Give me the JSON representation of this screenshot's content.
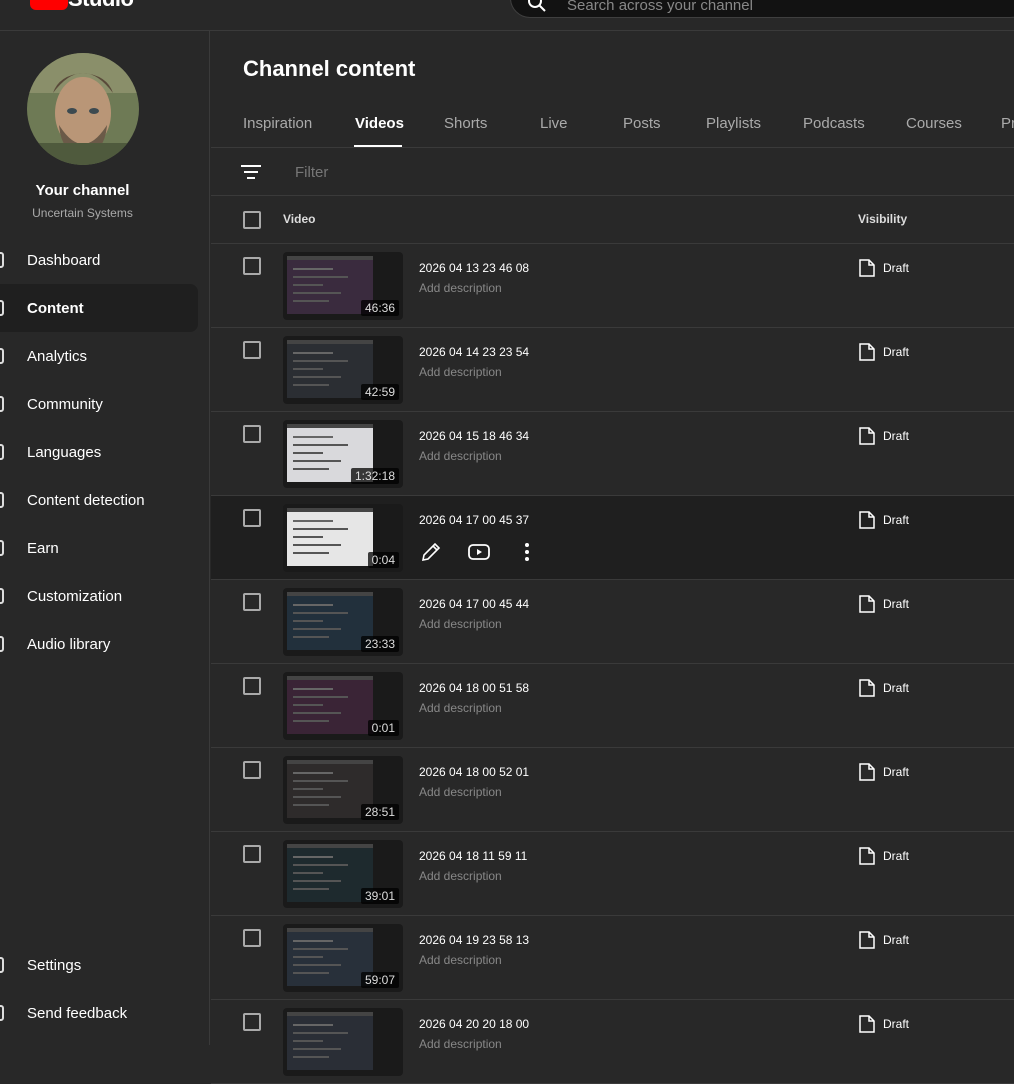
{
  "app": {
    "logo_text": "Studio"
  },
  "search": {
    "placeholder": "Search across your channel"
  },
  "sidebar": {
    "channel_title": "Your channel",
    "channel_name": "Uncertain Systems",
    "items": [
      {
        "label": "Dashboard",
        "icon": "dashboard-icon"
      },
      {
        "label": "Content",
        "icon": "content-icon",
        "active": true
      },
      {
        "label": "Analytics",
        "icon": "analytics-icon"
      },
      {
        "label": "Community",
        "icon": "community-icon"
      },
      {
        "label": "Languages",
        "icon": "languages-icon"
      },
      {
        "label": "Content detection",
        "icon": "content-detection-icon"
      },
      {
        "label": "Earn",
        "icon": "earn-icon"
      },
      {
        "label": "Customization",
        "icon": "customization-icon"
      },
      {
        "label": "Audio library",
        "icon": "audio-library-icon"
      }
    ],
    "bottom_items": [
      {
        "label": "Settings",
        "icon": "settings-icon"
      },
      {
        "label": "Send feedback",
        "icon": "feedback-icon"
      }
    ]
  },
  "main": {
    "title": "Channel content",
    "tabs": [
      "Inspiration",
      "Videos",
      "Shorts",
      "Live",
      "Posts",
      "Playlists",
      "Podcasts",
      "Courses",
      "Pr"
    ],
    "active_tab": "Videos",
    "filter_placeholder": "Filter",
    "columns": {
      "video": "Video",
      "visibility": "Visibility"
    },
    "rows": [
      {
        "title": "2026 04 13 23 46 08",
        "description": "Add description",
        "duration": "46:36",
        "visibility": "Draft"
      },
      {
        "title": "2026 04 14 23 23 54",
        "description": "Add description",
        "duration": "42:59",
        "visibility": "Draft"
      },
      {
        "title": "2026 04 15 18 46 34",
        "description": "Add description",
        "duration": "1:32:18",
        "visibility": "Draft"
      },
      {
        "title": "2026 04 17 00 45 37",
        "description": "",
        "duration": "0:04",
        "visibility": "Draft",
        "hover": true
      },
      {
        "title": "2026 04 17 00 45 44",
        "description": "Add description",
        "duration": "23:33",
        "visibility": "Draft"
      },
      {
        "title": "2026 04 18 00 51 58",
        "description": "Add description",
        "duration": "0:01",
        "visibility": "Draft"
      },
      {
        "title": "2026 04 18 00 52 01",
        "description": "Add description",
        "duration": "28:51",
        "visibility": "Draft"
      },
      {
        "title": "2026 04 18 11 59 11",
        "description": "Add description",
        "duration": "39:01",
        "visibility": "Draft"
      },
      {
        "title": "2026 04 19 23 58 13",
        "description": "Add description",
        "duration": "59:07",
        "visibility": "Draft"
      },
      {
        "title": "2026 04 20 20 18 00",
        "description": "Add description",
        "duration": "",
        "visibility": "Draft"
      }
    ]
  },
  "colors": {
    "background": "#282828",
    "active_nav": "#1f1f1f",
    "brand": "#ff0000",
    "muted_text": "#888888"
  }
}
